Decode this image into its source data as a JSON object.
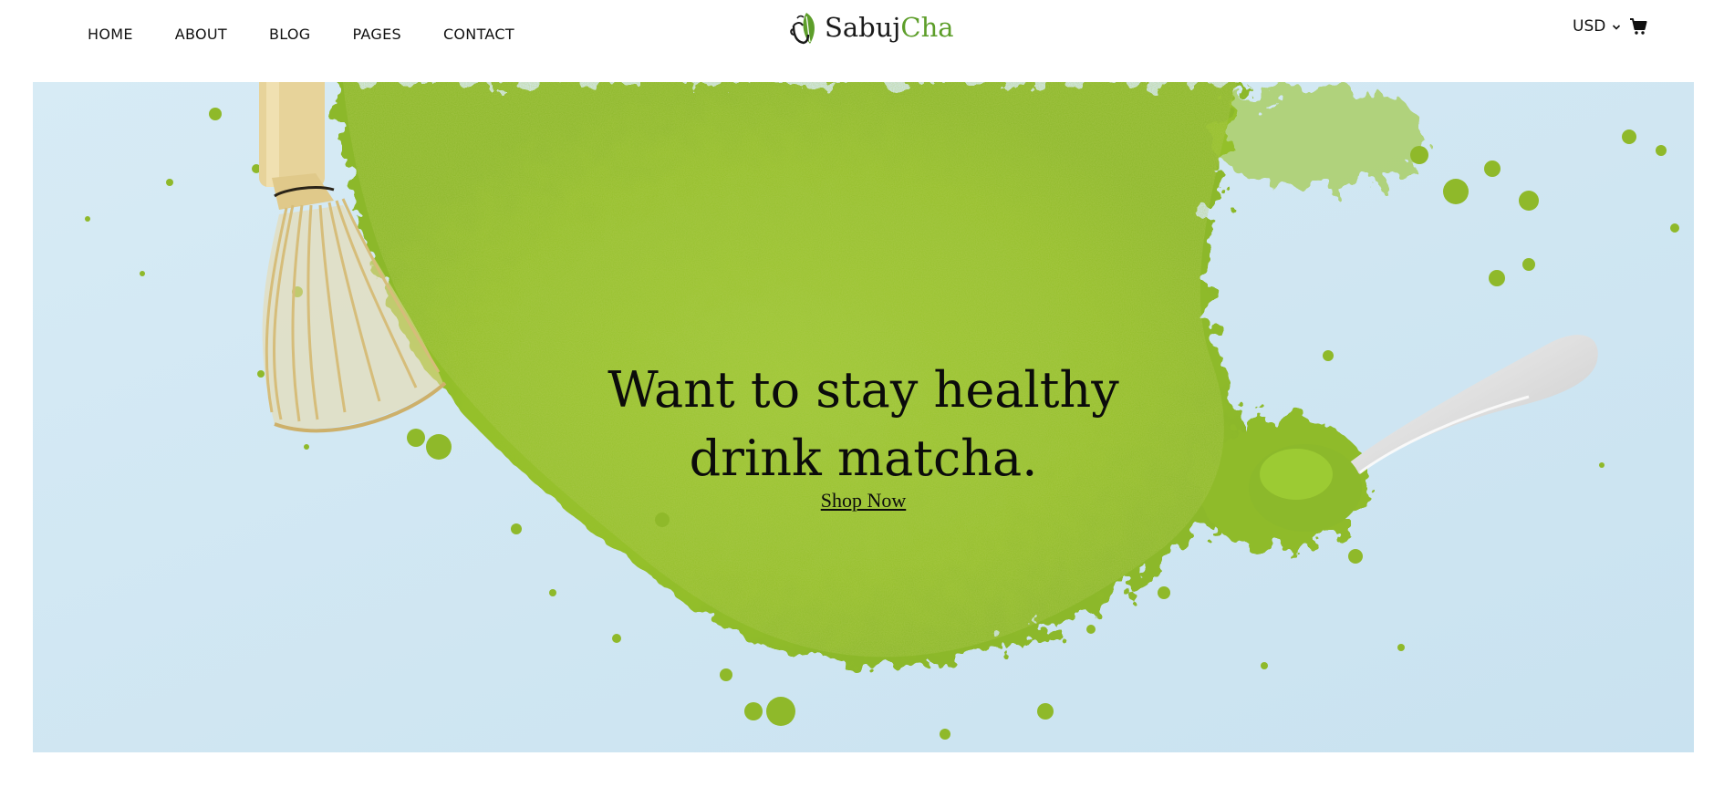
{
  "brand": {
    "name_part1": "Sabuj",
    "name_part2": "Cha",
    "accent_color": "#5d9e2a"
  },
  "nav": {
    "items": [
      {
        "label": "HOME"
      },
      {
        "label": "ABOUT"
      },
      {
        "label": "BLOG"
      },
      {
        "label": "PAGES"
      },
      {
        "label": "CONTACT"
      }
    ]
  },
  "header": {
    "currency": "USD",
    "currency_icon": "chevron-down-icon",
    "cart_icon": "cart-icon"
  },
  "hero": {
    "title_line1": "Want to stay healthy",
    "title_line2": "drink matcha.",
    "cta_label": "Shop Now",
    "background_color": "#d3e8f3",
    "matcha_color": "#9ac52e"
  }
}
